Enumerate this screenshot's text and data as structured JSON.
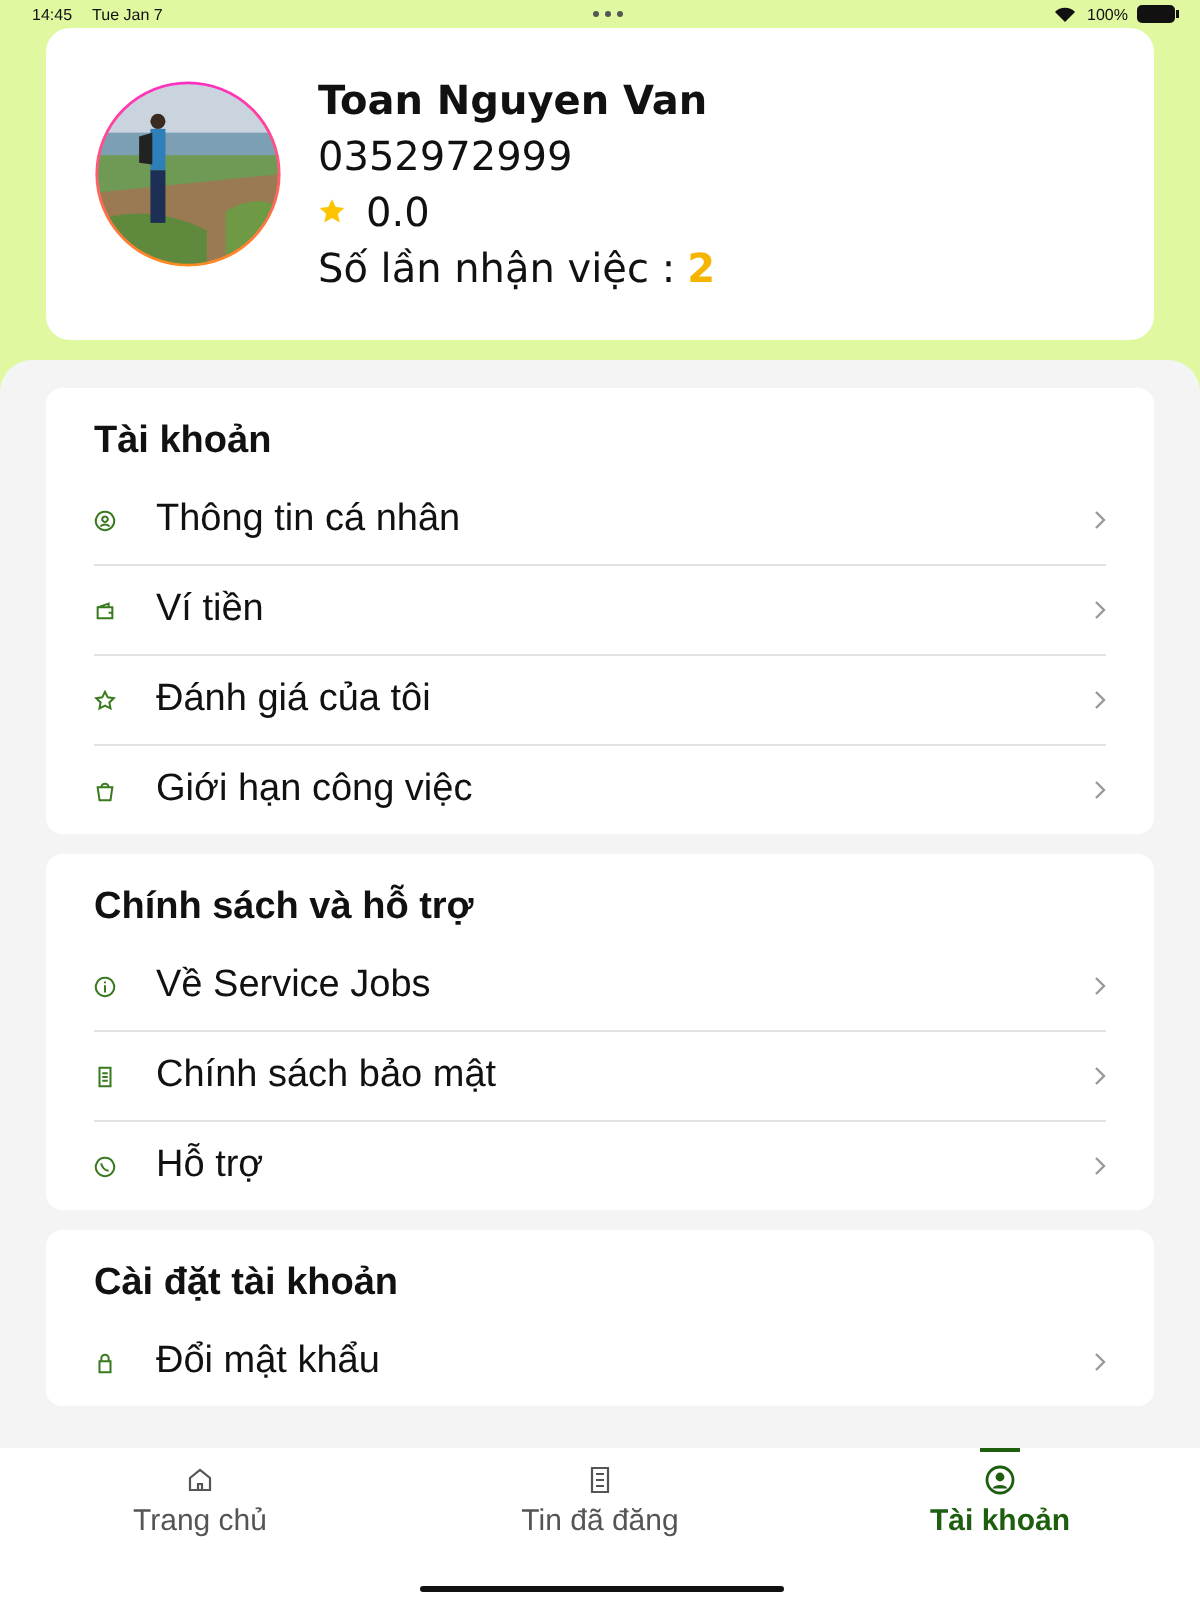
{
  "status_bar": {
    "time": "14:45",
    "date": "Tue Jan 7",
    "battery": "100%"
  },
  "profile": {
    "name": "Toan Nguyen Van",
    "phone": "0352972999",
    "rating": "0.0",
    "jobs_label": "Số lần nhận việc :",
    "jobs_count": "2"
  },
  "sections": [
    {
      "title": "Tài khoản",
      "items": [
        {
          "label": "Thông tin cá nhân"
        },
        {
          "label": "Ví tiền"
        },
        {
          "label": "Đánh giá của tôi"
        },
        {
          "label": "Giới hạn công việc"
        }
      ]
    },
    {
      "title": "Chính sách và hỗ trợ",
      "items": [
        {
          "label": "Về Service Jobs"
        },
        {
          "label": "Chính sách bảo mật"
        },
        {
          "label": "Hỗ trợ"
        }
      ]
    },
    {
      "title": "Cài đặt tài khoản",
      "items": [
        {
          "label": "Đổi mật khẩu"
        }
      ]
    }
  ],
  "tabs": [
    {
      "label": "Trang chủ",
      "selected": false
    },
    {
      "label": "Tin đã đăng",
      "selected": false
    },
    {
      "label": "Tài khoản",
      "selected": true
    }
  ]
}
